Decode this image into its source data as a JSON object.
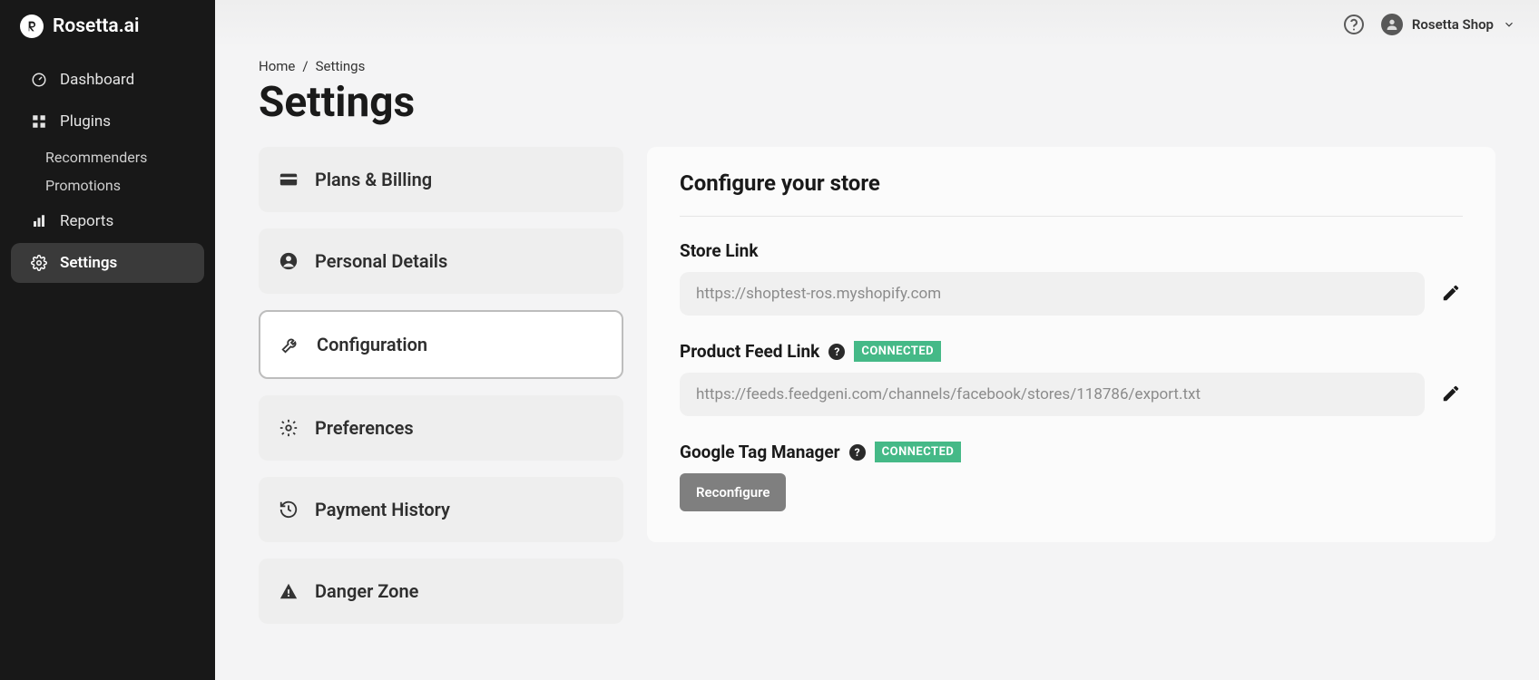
{
  "brand": {
    "name": "Rosetta.ai"
  },
  "topbar": {
    "user_name": "Rosetta Shop"
  },
  "sidebar": {
    "items": [
      {
        "label": "Dashboard"
      },
      {
        "label": "Plugins"
      },
      {
        "label": "Reports"
      },
      {
        "label": "Settings"
      }
    ],
    "plugins_sub": [
      {
        "label": "Recommenders"
      },
      {
        "label": "Promotions"
      }
    ]
  },
  "breadcrumb": {
    "home": "Home",
    "current": "Settings"
  },
  "page": {
    "title": "Settings"
  },
  "settings_menu": [
    {
      "label": "Plans & Billing"
    },
    {
      "label": "Personal Details"
    },
    {
      "label": "Configuration"
    },
    {
      "label": "Preferences"
    },
    {
      "label": "Payment History"
    },
    {
      "label": "Danger Zone"
    }
  ],
  "config": {
    "panel_title": "Configure your store",
    "store_link": {
      "label": "Store Link",
      "value": "https://shoptest-ros.myshopify.com"
    },
    "feed_link": {
      "label": "Product Feed Link",
      "status": "CONNECTED",
      "value": "https://feeds.feedgeni.com/channels/facebook/stores/118786/export.txt"
    },
    "gtm": {
      "label": "Google Tag Manager",
      "status": "CONNECTED",
      "button": "Reconfigure"
    }
  }
}
